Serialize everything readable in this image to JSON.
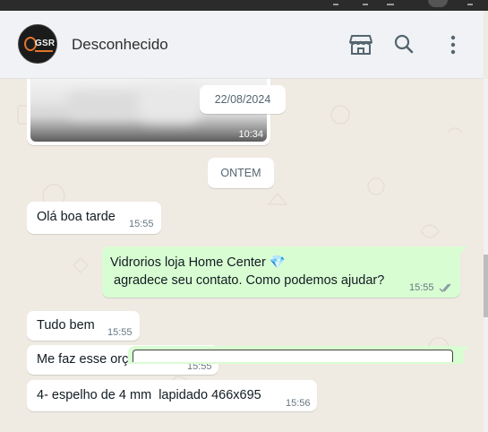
{
  "header": {
    "avatar_text": "GSR",
    "contact_name": "Desconhecido",
    "icons": [
      "catalog-store-icon",
      "search-icon",
      "menu-dots-icon"
    ]
  },
  "chat": {
    "image_message": {
      "time": "10:34"
    },
    "date_chips": [
      "22/08/2024",
      "ONTEM"
    ],
    "messages": [
      {
        "direction": "in",
        "text": "Olá boa tarde",
        "time": "15:55"
      },
      {
        "direction": "out",
        "lines": [
          "Vidrorios loja Home Center 💎",
          " agradece seu contato. Como podemos ajudar?"
        ],
        "time": "15:55",
        "status": "read"
      },
      {
        "direction": "in",
        "text": "Tudo bem",
        "time": "15:55"
      },
      {
        "direction": "in",
        "text": "Me faz esse orçamento",
        "time": "15:55"
      },
      {
        "direction": "in",
        "text": "4- espelho de 4 mm  lapidado 466x695",
        "time": "15:56"
      }
    ]
  },
  "colors": {
    "incoming_bubble": "#ffffff",
    "outgoing_bubble": "#d9fdd3",
    "chat_background": "#efeae2",
    "read_ticks": "#53bdeb"
  }
}
